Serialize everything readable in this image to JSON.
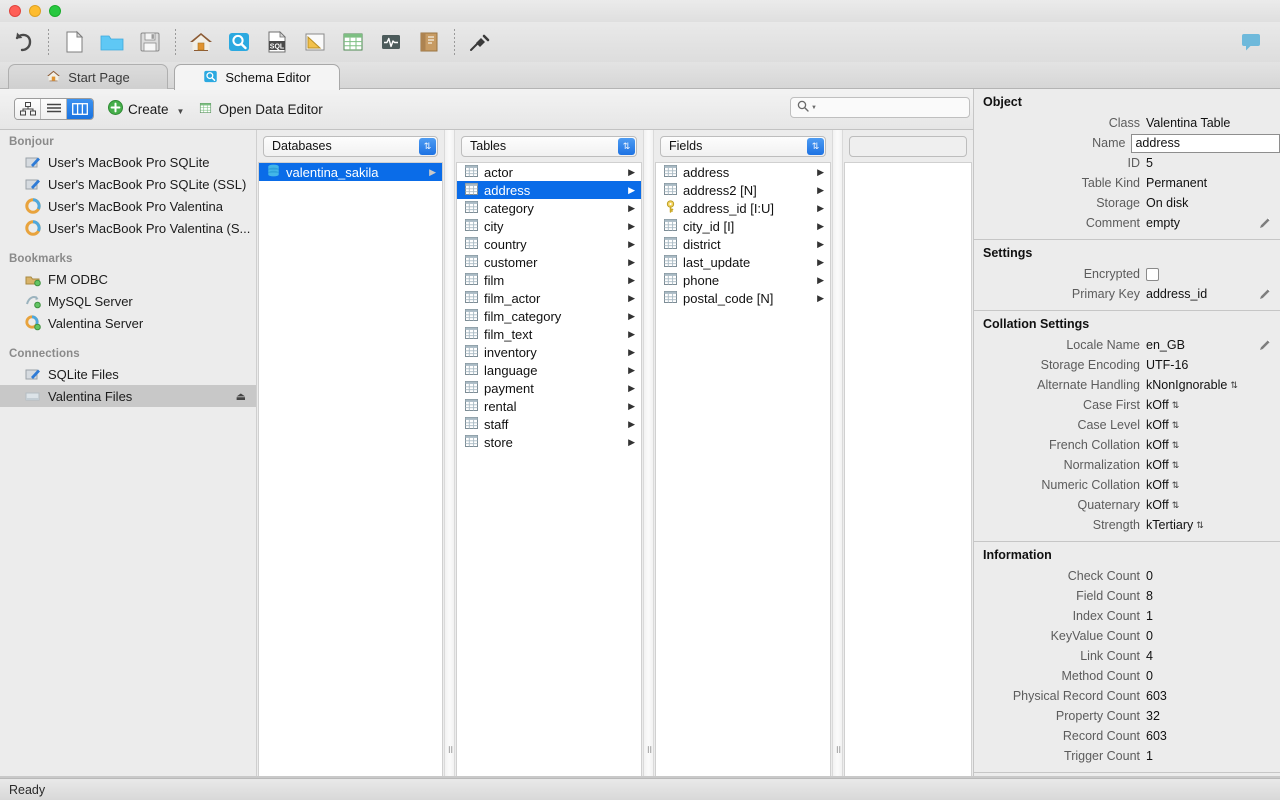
{
  "window": {
    "traffic_lights": [
      "close",
      "minimize",
      "zoom"
    ]
  },
  "toolbar": {
    "items": [
      {
        "name": "undo-icon",
        "label": "Undo"
      },
      {
        "name": "new-document-icon",
        "label": "New"
      },
      {
        "name": "open-folder-icon",
        "label": "Open"
      },
      {
        "name": "save-floppy-icon",
        "label": "Save"
      },
      {
        "name": "home-icon",
        "label": "Start Page"
      },
      {
        "name": "schema-editor-icon",
        "label": "Schema Editor"
      },
      {
        "name": "sql-editor-icon",
        "label": "SQL Editor"
      },
      {
        "name": "diagram-icon",
        "label": "Diagram"
      },
      {
        "name": "data-editor-icon",
        "label": "Data Editor"
      },
      {
        "name": "monitor-icon",
        "label": "Monitor"
      },
      {
        "name": "reports-icon",
        "label": "Reports"
      },
      {
        "name": "connect-plug-icon",
        "label": "Connect"
      }
    ],
    "right_items": [
      {
        "name": "chat-bubble-icon",
        "label": "Chat"
      }
    ]
  },
  "tabs": [
    {
      "label": "Start Page",
      "icon": "home-icon",
      "active": false
    },
    {
      "label": "Schema Editor",
      "icon": "schema-editor-icon",
      "active": true
    }
  ],
  "actionbar": {
    "view_modes": [
      {
        "name": "diagram-view",
        "selected": false
      },
      {
        "name": "list-view",
        "selected": false
      },
      {
        "name": "column-view",
        "selected": true
      }
    ],
    "create_label": "Create",
    "open_data_editor_label": "Open Data Editor"
  },
  "search": {
    "value": "",
    "placeholder": "",
    "icon": "search-icon"
  },
  "sidebar": {
    "groups": [
      {
        "title": "Bonjour",
        "items": [
          {
            "label": "User's MacBook Pro SQLite",
            "icon": "sqlite-icon",
            "selected": false
          },
          {
            "label": "User's MacBook Pro SQLite (SSL)",
            "icon": "sqlite-icon",
            "selected": false
          },
          {
            "label": "User's MacBook Pro Valentina",
            "icon": "valentina-icon",
            "selected": false
          },
          {
            "label": "User's MacBook Pro Valentina (S...",
            "icon": "valentina-icon",
            "selected": false
          }
        ]
      },
      {
        "title": "Bookmarks",
        "items": [
          {
            "label": "FM ODBC",
            "icon": "odbc-icon",
            "selected": false
          },
          {
            "label": "MySQL Server",
            "icon": "mysql-icon",
            "selected": false
          },
          {
            "label": "Valentina Server",
            "icon": "valentina-server-icon",
            "selected": false
          }
        ]
      },
      {
        "title": "Connections",
        "items": [
          {
            "label": "SQLite Files",
            "icon": "sqlite-icon",
            "selected": false
          },
          {
            "label": "Valentina Files",
            "icon": "valentina-files-icon",
            "selected": true,
            "eject": "⏏"
          }
        ]
      }
    ]
  },
  "browser": {
    "columns": [
      {
        "header": "Databases",
        "disabled": false,
        "rows": [
          {
            "label": "valentina_sakila",
            "icon": "database-icon",
            "selected": true,
            "arrow": "▶",
            "style": "database"
          }
        ]
      },
      {
        "header": "Tables",
        "disabled": false,
        "rows": [
          {
            "label": "actor",
            "icon": "table-icon",
            "selected": false,
            "arrow": "▶"
          },
          {
            "label": "address",
            "icon": "table-icon",
            "selected": true,
            "arrow": "▶"
          },
          {
            "label": "category",
            "icon": "table-icon",
            "selected": false,
            "arrow": "▶"
          },
          {
            "label": "city",
            "icon": "table-icon",
            "selected": false,
            "arrow": "▶"
          },
          {
            "label": "country",
            "icon": "table-icon",
            "selected": false,
            "arrow": "▶"
          },
          {
            "label": "customer",
            "icon": "table-icon",
            "selected": false,
            "arrow": "▶"
          },
          {
            "label": "film",
            "icon": "table-icon",
            "selected": false,
            "arrow": "▶"
          },
          {
            "label": "film_actor",
            "icon": "table-icon",
            "selected": false,
            "arrow": "▶"
          },
          {
            "label": "film_category",
            "icon": "table-icon",
            "selected": false,
            "arrow": "▶"
          },
          {
            "label": "film_text",
            "icon": "table-icon",
            "selected": false,
            "arrow": "▶"
          },
          {
            "label": "inventory",
            "icon": "table-icon",
            "selected": false,
            "arrow": "▶"
          },
          {
            "label": "language",
            "icon": "table-icon",
            "selected": false,
            "arrow": "▶"
          },
          {
            "label": "payment",
            "icon": "table-icon",
            "selected": false,
            "arrow": "▶"
          },
          {
            "label": "rental",
            "icon": "table-icon",
            "selected": false,
            "arrow": "▶"
          },
          {
            "label": "staff",
            "icon": "table-icon",
            "selected": false,
            "arrow": "▶"
          },
          {
            "label": "store",
            "icon": "table-icon",
            "selected": false,
            "arrow": "▶"
          }
        ]
      },
      {
        "header": "Fields",
        "disabled": false,
        "rows": [
          {
            "label": "address",
            "icon": "field-icon",
            "selected": false,
            "arrow": "▶"
          },
          {
            "label": "address2 [N]",
            "icon": "field-icon",
            "selected": false,
            "arrow": "▶"
          },
          {
            "label": "address_id [I:U]",
            "icon": "primary-key-icon",
            "selected": false,
            "arrow": "▶"
          },
          {
            "label": "city_id [I]",
            "icon": "field-icon",
            "selected": false,
            "arrow": "▶"
          },
          {
            "label": "district",
            "icon": "field-icon",
            "selected": false,
            "arrow": "▶"
          },
          {
            "label": "last_update",
            "icon": "field-icon",
            "selected": false,
            "arrow": "▶"
          },
          {
            "label": "phone",
            "icon": "field-icon",
            "selected": false,
            "arrow": "▶"
          },
          {
            "label": "postal_code [N]",
            "icon": "field-icon",
            "selected": false,
            "arrow": "▶"
          }
        ]
      },
      {
        "header": "",
        "disabled": true,
        "rows": []
      }
    ]
  },
  "inspector": {
    "sections": [
      {
        "title": "Object",
        "rows": [
          {
            "label": "Class",
            "value": "Valentina Table",
            "kind": "text"
          },
          {
            "label": "Name",
            "value": "address",
            "kind": "input"
          },
          {
            "label": "ID",
            "value": "5",
            "kind": "text"
          },
          {
            "label": "Table Kind",
            "value": "Permanent",
            "kind": "text"
          },
          {
            "label": "Storage",
            "value": "On disk",
            "kind": "text"
          },
          {
            "label": "Comment",
            "value": "empty",
            "kind": "text",
            "edit": true
          }
        ]
      },
      {
        "title": "Settings",
        "rows": [
          {
            "label": "Encrypted",
            "value": "",
            "kind": "checkbox",
            "checked": false
          },
          {
            "label": "Primary Key",
            "value": "address_id",
            "kind": "text",
            "edit": true
          }
        ]
      },
      {
        "title": "Collation Settings",
        "rows": [
          {
            "label": "Locale Name",
            "value": "en_GB",
            "kind": "text",
            "edit": true
          },
          {
            "label": "Storage Encoding",
            "value": "UTF-16",
            "kind": "text"
          },
          {
            "label": "Alternate Handling",
            "value": "kNonIgnorable",
            "kind": "stepper"
          },
          {
            "label": "Case First",
            "value": "kOff",
            "kind": "stepper"
          },
          {
            "label": "Case Level",
            "value": "kOff",
            "kind": "stepper"
          },
          {
            "label": "French Collation",
            "value": "kOff",
            "kind": "stepper"
          },
          {
            "label": "Normalization",
            "value": "kOff",
            "kind": "stepper"
          },
          {
            "label": "Numeric Collation",
            "value": "kOff",
            "kind": "stepper"
          },
          {
            "label": "Quaternary",
            "value": "kOff",
            "kind": "stepper"
          },
          {
            "label": "Strength",
            "value": "kTertiary",
            "kind": "stepper"
          }
        ]
      },
      {
        "title": "Information",
        "rows": [
          {
            "label": "Check Count",
            "value": "0",
            "kind": "text"
          },
          {
            "label": "Field Count",
            "value": "8",
            "kind": "text"
          },
          {
            "label": "Index Count",
            "value": "1",
            "kind": "text"
          },
          {
            "label": "KeyValue Count",
            "value": "0",
            "kind": "text"
          },
          {
            "label": "Link Count",
            "value": "4",
            "kind": "text"
          },
          {
            "label": "Method Count",
            "value": "0",
            "kind": "text"
          },
          {
            "label": "Physical Record Count",
            "value": "603",
            "kind": "text"
          },
          {
            "label": "Property Count",
            "value": "32",
            "kind": "text"
          },
          {
            "label": "Record Count",
            "value": "603",
            "kind": "text"
          },
          {
            "label": "Trigger Count",
            "value": "1",
            "kind": "text"
          }
        ]
      }
    ]
  },
  "statusbar": {
    "message": "Ready"
  },
  "colors": {
    "selection_blue": "#0A6CE8",
    "accent_blue": "#1D72E3",
    "chrome_gray": "#ECECEC",
    "sidebar_selected": "#C8C8C8"
  }
}
